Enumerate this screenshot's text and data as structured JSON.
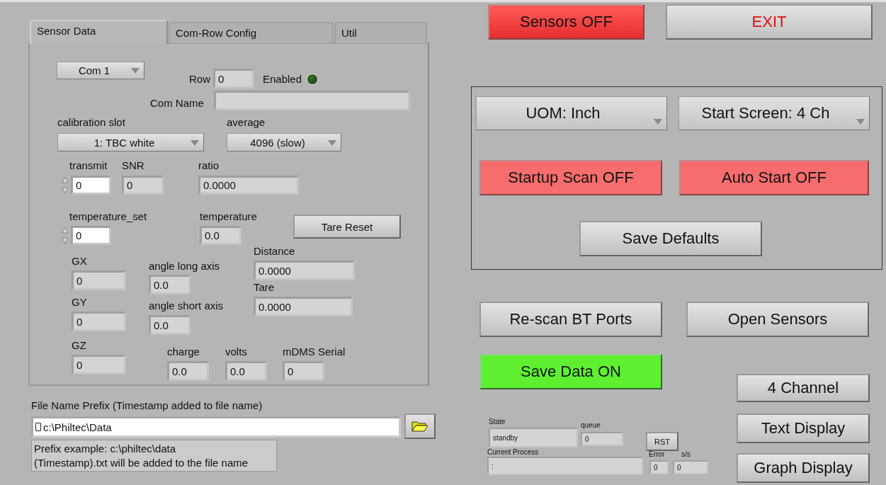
{
  "tabs": [
    {
      "label": "Sensor Data",
      "selected": true
    },
    {
      "label": "Com-Row Config",
      "selected": false
    },
    {
      "label": "Util",
      "selected": false
    }
  ],
  "sensor_data": [
    {
      "kind": "ring",
      "value": "Com 1"
    },
    {
      "kind": "indicator",
      "label": "Row",
      "value": "0"
    },
    {
      "kind": "led",
      "label": "Enabled",
      "on": false
    },
    {
      "kind": "indicator",
      "label": "Com Name"
    },
    {
      "kind": "ring",
      "label": "calibration slot",
      "value": "1: TBC white"
    },
    {
      "kind": "ring",
      "label": "average",
      "value": "4096 (slow)"
    },
    {
      "kind": "control",
      "label": "transmit",
      "value": "0"
    },
    {
      "kind": "indicator",
      "label": "SNR",
      "value": "0"
    },
    {
      "kind": "indicator",
      "label": "ratio",
      "value": "0.0000"
    },
    {
      "kind": "control",
      "label": "temperature_set",
      "value": "0"
    },
    {
      "kind": "indicator",
      "label": "temperature",
      "value": "0.0"
    },
    {
      "kind": "button",
      "value": "Tare Reset"
    },
    {
      "kind": "indicator",
      "label": "Distance",
      "value": "0.0000"
    },
    {
      "kind": "indicator",
      "label": "GX",
      "value": "0"
    },
    {
      "kind": "indicator",
      "label": "angle long axis",
      "value": "0.0"
    },
    {
      "kind": "indicator",
      "label": "Tare",
      "value": "0.0000"
    },
    {
      "kind": "indicator",
      "label": "GY",
      "value": "0"
    },
    {
      "kind": "indicator",
      "label": "angle short axis",
      "value": "0.0"
    },
    {
      "kind": "indicator",
      "label": "GZ",
      "value": "0"
    },
    {
      "kind": "indicator",
      "label": "charge",
      "value": "0.0"
    },
    {
      "kind": "indicator",
      "label": "volts",
      "value": "0.0"
    },
    {
      "kind": "indicator",
      "label": "mDMS Serial",
      "value": "0"
    }
  ],
  "file_name_prefix": {
    "label": "File Name Prefix (Timestamp added to file name)",
    "value": "c:\\Philtec\\Data",
    "note": "Prefix example: c:\\philtec\\data\n(Timestamp).txt will be added to the file name"
  },
  "top_buttons": [
    {
      "kind": "toggle",
      "value": "Sensors OFF",
      "on": false
    },
    {
      "kind": "exit",
      "value": "EXIT"
    }
  ],
  "settings": [
    {
      "kind": "ring",
      "value": "UOM: Inch"
    },
    {
      "kind": "ring",
      "value": "Start Screen: 4 Ch"
    },
    {
      "kind": "toggle",
      "value": "Startup Scan OFF",
      "on": false
    },
    {
      "kind": "toggle",
      "value": "Auto Start OFF",
      "on": false
    },
    {
      "kind": "button",
      "value": "Save Defaults"
    }
  ],
  "actions": [
    {
      "kind": "button",
      "value": "Re-scan BT Ports"
    },
    {
      "kind": "button",
      "value": "Open Sensors"
    },
    {
      "kind": "toggle",
      "value": "Save Data ON",
      "on": true
    },
    {
      "kind": "button",
      "value": "4 Channel"
    },
    {
      "kind": "button",
      "value": "Text Display"
    },
    {
      "kind": "button",
      "value": "Graph Display"
    }
  ],
  "status": [
    {
      "kind": "indicator",
      "label": "State",
      "value": "standby"
    },
    {
      "kind": "indicator",
      "label": "queue",
      "value": "0"
    },
    {
      "kind": "button",
      "value": "RST"
    },
    {
      "kind": "indicator",
      "label": "Current Process",
      "value": ":"
    },
    {
      "kind": "indicator",
      "label": "Error",
      "value": "0"
    },
    {
      "kind": "indicator",
      "label": "s/s",
      "value": "0"
    }
  ]
}
